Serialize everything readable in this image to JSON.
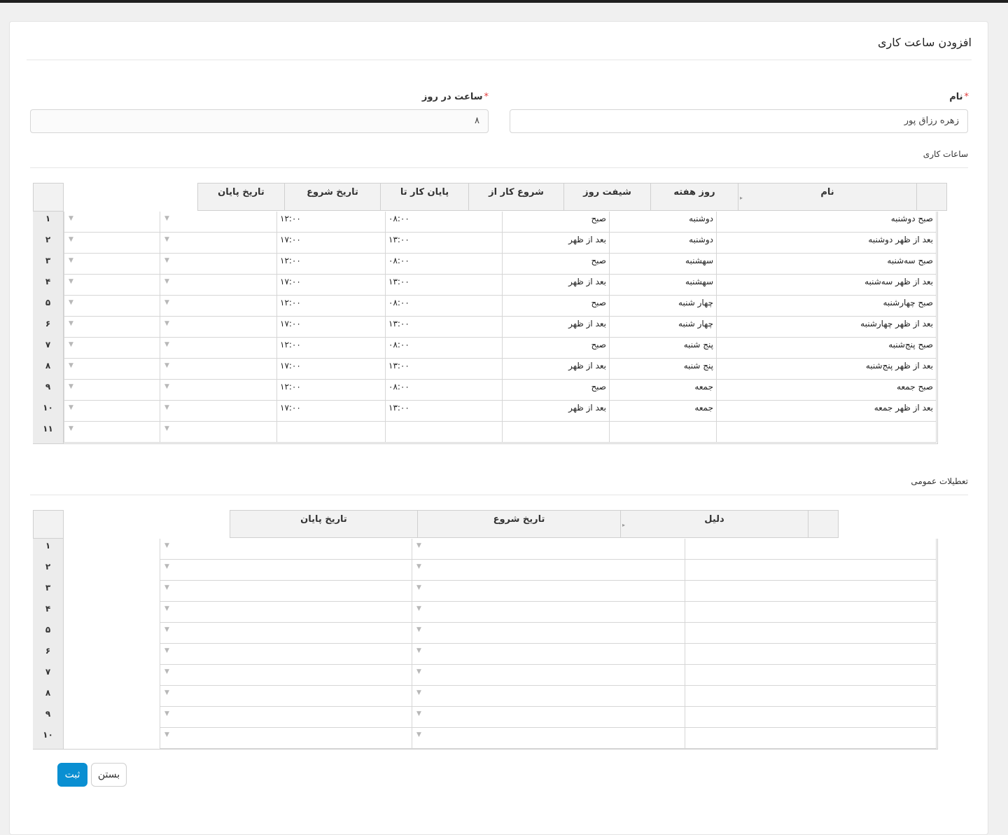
{
  "page": {
    "title": "افزودن ساعت کاری"
  },
  "form": {
    "name_label": "نام",
    "name_value": "زهره رزاق پور",
    "hours_label": "ساعت در روز",
    "hours_value": "۸",
    "required_mark": "*"
  },
  "work_hours": {
    "section_title": "ساعات کاری",
    "columns": {
      "name": "نام",
      "weekday": "روز هفته",
      "shift": "شیفت روز",
      "start": "شروع کار از",
      "end": "پایان کار تا",
      "start_date": "تاریخ شروع",
      "end_date": "تاریخ پایان"
    },
    "rows": [
      {
        "num": "۱",
        "name": "صبح دوشنبه",
        "weekday": "دوشنبه",
        "shift": "صبح",
        "start": "۰۸:۰۰",
        "end": "۱۲:۰۰"
      },
      {
        "num": "۲",
        "name": "بعد از ظهر دوشنبه",
        "weekday": "دوشنبه",
        "shift": "بعد از ظهر",
        "start": "۱۳:۰۰",
        "end": "۱۷:۰۰"
      },
      {
        "num": "۳",
        "name": "صبح سه‌شنبه",
        "weekday": "سهشنبه",
        "shift": "صبح",
        "start": "۰۸:۰۰",
        "end": "۱۲:۰۰"
      },
      {
        "num": "۴",
        "name": "بعد از ظهر سه‌شنبه",
        "weekday": "سهشنبه",
        "shift": "بعد از ظهر",
        "start": "۱۳:۰۰",
        "end": "۱۷:۰۰"
      },
      {
        "num": "۵",
        "name": "صبح چهارشنبه",
        "weekday": "چهار شنبه",
        "shift": "صبح",
        "start": "۰۸:۰۰",
        "end": "۱۲:۰۰"
      },
      {
        "num": "۶",
        "name": "بعد از ظهر چهارشنبه",
        "weekday": "چهار شنبه",
        "shift": "بعد از ظهر",
        "start": "۱۳:۰۰",
        "end": "۱۷:۰۰"
      },
      {
        "num": "۷",
        "name": "صبح پنج‌شنبه",
        "weekday": "پنج شنبه",
        "shift": "صبح",
        "start": "۰۸:۰۰",
        "end": "۱۲:۰۰"
      },
      {
        "num": "۸",
        "name": "بعد از ظهر پنج‌شنبه",
        "weekday": "پنج شنبه",
        "shift": "بعد از ظهر",
        "start": "۱۳:۰۰",
        "end": "۱۷:۰۰"
      },
      {
        "num": "۹",
        "name": "صبح جمعه",
        "weekday": "جمعه",
        "shift": "صبح",
        "start": "۰۸:۰۰",
        "end": "۱۲:۰۰"
      },
      {
        "num": "۱۰",
        "name": "بعد از ظهر جمعه",
        "weekday": "جمعه",
        "shift": "بعد از ظهر",
        "start": "۱۳:۰۰",
        "end": "۱۷:۰۰"
      },
      {
        "num": "۱۱",
        "name": "",
        "weekday": "",
        "shift": "",
        "start": "",
        "end": ""
      }
    ]
  },
  "holidays": {
    "section_title": "تعطیلات عمومی",
    "columns": {
      "reason": "دلیل",
      "start_date": "تاریخ شروع",
      "end_date": "تاریخ پایان"
    },
    "rows": [
      {
        "num": "۱"
      },
      {
        "num": "۲"
      },
      {
        "num": "۳"
      },
      {
        "num": "۴"
      },
      {
        "num": "۵"
      },
      {
        "num": "۶"
      },
      {
        "num": "۷"
      },
      {
        "num": "۸"
      },
      {
        "num": "۹"
      },
      {
        "num": "۱۰"
      }
    ]
  },
  "buttons": {
    "submit": "ثبت",
    "close": "بستن"
  },
  "colors": {
    "primary": "#0a8fd2",
    "required": "#e03c3c"
  },
  "icons": {
    "dropdown": "dropdown-triangle-icon",
    "sort": "sort-triangle-icon"
  }
}
